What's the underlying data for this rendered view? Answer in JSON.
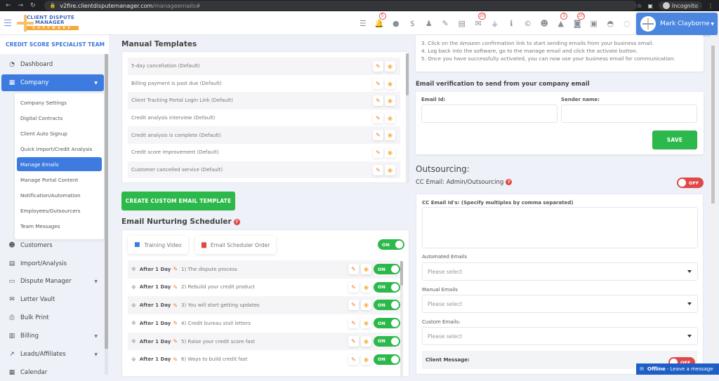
{
  "browser": {
    "url_host": "v2fire.clientdisputemanager.com",
    "url_path": "/manageemails#",
    "profile_label": "Incognito"
  },
  "header": {
    "logo": {
      "line1": "CLIENT DISPUTE",
      "line2": "MANAGER",
      "line3": "SOFTWARE"
    },
    "icons": [
      {
        "name": "tasks-icon",
        "glyph": "☰",
        "badge": null
      },
      {
        "name": "bell-icon",
        "glyph": "🔔",
        "badge": "5"
      },
      {
        "name": "client-icon",
        "glyph": "●",
        "badge": null
      },
      {
        "name": "dollar-icon",
        "glyph": "$",
        "badge": null
      },
      {
        "name": "user-tie-icon",
        "glyph": "♟",
        "badge": null
      },
      {
        "name": "pen-icon",
        "glyph": "✎",
        "badge": null
      },
      {
        "name": "document-icon",
        "glyph": "▤",
        "badge": null
      },
      {
        "name": "envelope-icon",
        "glyph": "✉",
        "badge": "20"
      },
      {
        "name": "sitemap-icon",
        "glyph": "⚶",
        "badge": null
      },
      {
        "name": "info-icon",
        "glyph": "ℹ",
        "badge": null
      },
      {
        "name": "copyright-icon",
        "glyph": "©",
        "badge": null
      },
      {
        "name": "users-icon",
        "glyph": "☻",
        "badge": null
      },
      {
        "name": "warning-icon",
        "glyph": "▲",
        "badge": "3"
      },
      {
        "name": "inbox-alert-icon",
        "glyph": "◙",
        "badge": "20"
      },
      {
        "name": "money-icon",
        "glyph": "▣",
        "badge": null
      },
      {
        "name": "tray-icon",
        "glyph": "◓",
        "badge": null
      },
      {
        "name": "chat-icon",
        "glyph": "◌",
        "badge": null
      },
      {
        "name": "copy-icon",
        "glyph": "❐",
        "badge": null
      }
    ],
    "user_name": "Mark Clayborne"
  },
  "sidebar": {
    "team_name": "CREDIT SCORE SPECIALIST TEAM",
    "items": [
      {
        "label": "Dashboard",
        "icon": "◔",
        "caret": false
      },
      {
        "label": "Company",
        "icon": "▦",
        "caret": true,
        "active": true
      },
      {
        "label": "Customers",
        "icon": "☻",
        "caret": false
      },
      {
        "label": "Import/Analysis",
        "icon": "▤",
        "caret": false
      },
      {
        "label": "Dispute Manager",
        "icon": "▭",
        "caret": true
      },
      {
        "label": "Letter Vault",
        "icon": "✉",
        "caret": false
      },
      {
        "label": "Bulk Print",
        "icon": "⎙",
        "caret": false
      },
      {
        "label": "Billing",
        "icon": "▥",
        "caret": true
      },
      {
        "label": "Leads/Affiliates",
        "icon": "↗",
        "caret": true
      },
      {
        "label": "Calendar",
        "icon": "▦",
        "caret": false
      }
    ],
    "company_submenu": [
      {
        "label": "Company Settings"
      },
      {
        "label": "Digital Contracts"
      },
      {
        "label": "Client Auto Signup"
      },
      {
        "label": "Quick Import/Credit Analysis"
      },
      {
        "label": "Manage Emails",
        "active": true
      },
      {
        "label": "Manage Portal Content"
      },
      {
        "label": "Notification/Automation"
      },
      {
        "label": "Employees/Outsourcers"
      },
      {
        "label": "Team Messages"
      }
    ]
  },
  "manual_templates": {
    "title": "Manual Templates",
    "rows": [
      "5-day cancellation (Default)",
      "Billing payment is past due (Default)",
      "Client Tracking Portal Login Link (Default)",
      "Credit analysis interview (Default)",
      "Credit analysis is complete (Default)",
      "Credit score improvement (Default)",
      "Customer cancelled service (Default)"
    ],
    "create_button": "CREATE CUSTOM EMAIL TEMPLATE"
  },
  "scheduler": {
    "title": "Email Nurturing Scheduler",
    "training_video": "Training Video",
    "scheduler_order": "Email Scheduler Order",
    "master_toggle": "ON",
    "rows": [
      {
        "delay": "After 1 Day",
        "subject": "1) The dispute process",
        "state": "ON"
      },
      {
        "delay": "After 1 Day",
        "subject": "2) Rebuild your credit product",
        "state": "ON"
      },
      {
        "delay": "After 1 Day",
        "subject": "3) You will start getting updates",
        "state": "ON"
      },
      {
        "delay": "After 1 Day",
        "subject": "4) Credit bureau stall letters",
        "state": "ON"
      },
      {
        "delay": "After 1 Day",
        "subject": "5) Raise your credit score fast",
        "state": "ON"
      },
      {
        "delay": "After 1 Day",
        "subject": "6) Ways to build credit fast",
        "state": "ON"
      }
    ]
  },
  "instructions": {
    "steps": [
      "3. Click on the Amazon confirmation link to start sending emails from your business email.",
      "4. Log back into the software, go to the manage email and click the activate button.",
      "5. Once you have successfully activated, you can now use your business email for communication."
    ]
  },
  "verification": {
    "title": "Email verification to send from your company email",
    "email_label": "Email Id:",
    "email_value": "",
    "sender_label": "Sender name:",
    "sender_value": "",
    "save_button": "SAVE"
  },
  "outsourcing": {
    "title": "Outsourcing:",
    "cc_label": "CC Email: Admin/Outsourcing",
    "cc_toggle": "OFF",
    "cc_ids_label": "CC Email Id's: (Specify multiples by comma separated)",
    "cc_ids_value": "",
    "automated_label": "Automated Emails",
    "automated_value": "Please select",
    "manual_label": "Manual Emails",
    "manual_value": "Please select",
    "custom_label": "Custom Emails:",
    "custom_value": "Please select",
    "client_message_label": "Client Message:",
    "client_message_toggle": "OFF"
  },
  "chat_widget": {
    "status": "Offline",
    "text": "- Leave a message"
  },
  "colors": {
    "primary": "#3d7be0",
    "success": "#2db84b",
    "danger": "#e04848",
    "edit": "#ef7a2a",
    "view": "#f3b23d"
  }
}
